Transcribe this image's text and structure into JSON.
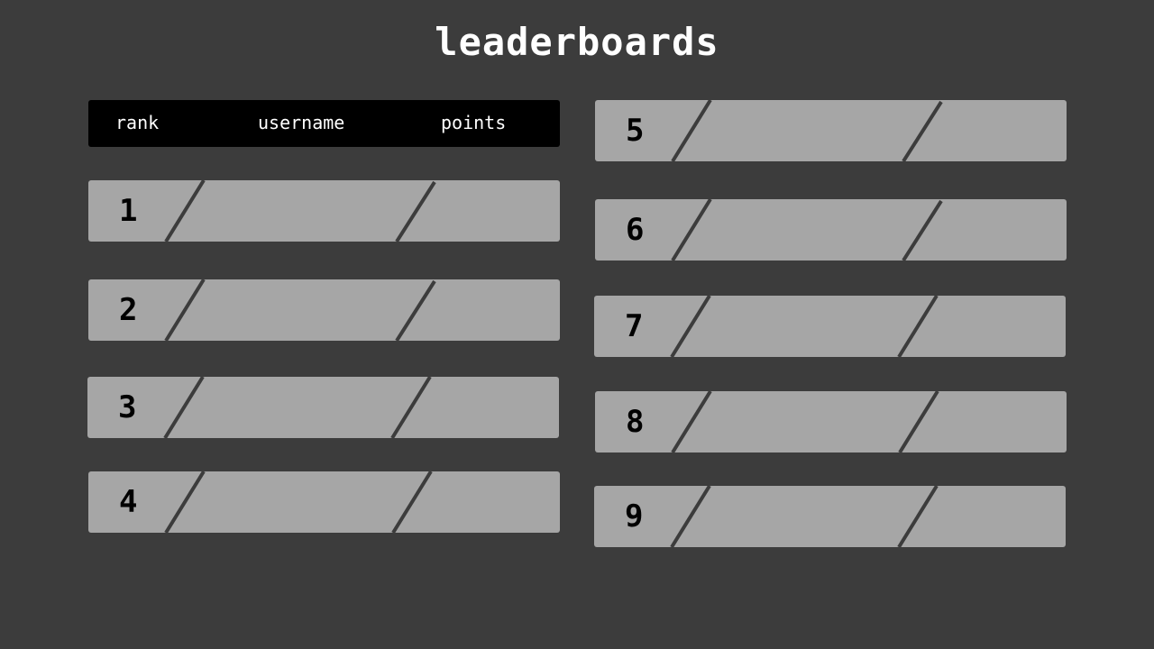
{
  "title": "leaderboards",
  "header": {
    "rank": "rank",
    "username": "username",
    "points": "points"
  },
  "rows": [
    {
      "rank": "1",
      "username": "",
      "points": ""
    },
    {
      "rank": "2",
      "username": "",
      "points": ""
    },
    {
      "rank": "3",
      "username": "",
      "points": ""
    },
    {
      "rank": "4",
      "username": "",
      "points": ""
    },
    {
      "rank": "5",
      "username": "",
      "points": ""
    },
    {
      "rank": "6",
      "username": "",
      "points": ""
    },
    {
      "rank": "7",
      "username": "",
      "points": ""
    },
    {
      "rank": "8",
      "username": "",
      "points": ""
    },
    {
      "rank": "9",
      "username": "",
      "points": ""
    }
  ],
  "colors": {
    "background": "#3c3c3c",
    "row": "#a6a6a6",
    "header": "#000000",
    "divider": "#3c3c3c"
  }
}
